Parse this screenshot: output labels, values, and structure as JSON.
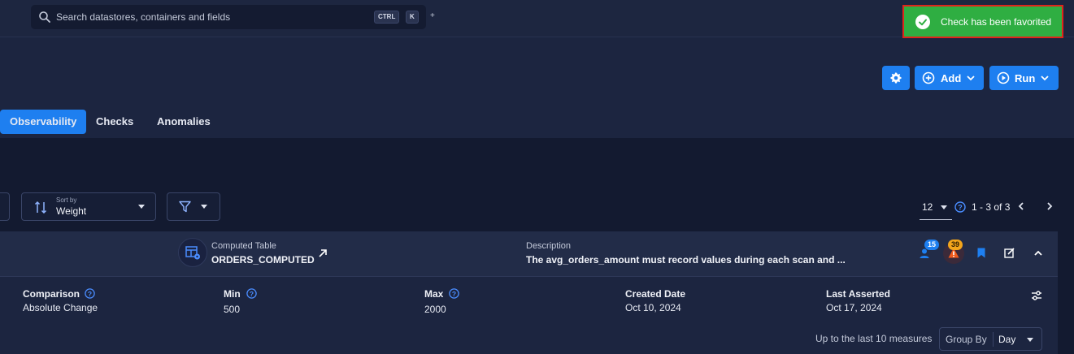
{
  "search": {
    "placeholder": "Search datastores, containers and fields",
    "shortcut_key1": "CTRL",
    "shortcut_plus": "+",
    "shortcut_key2": "K"
  },
  "toast": {
    "message": "Check has been favorited",
    "color": "#2fae42"
  },
  "actions": {
    "settings_icon": "gear-icon",
    "add_label": "Add",
    "run_label": "Run",
    "accent": "#1e7ff0"
  },
  "tabs": [
    {
      "label": "Observability",
      "active": true
    },
    {
      "label": "Checks",
      "active": false
    },
    {
      "label": "Anomalies",
      "active": false
    }
  ],
  "controls": {
    "sort_by_label": "Sort by",
    "sort_by_value": "Weight",
    "page_size": "12",
    "pagination_text": "1 - 3 of 3"
  },
  "card": {
    "container_type_label": "Computed Table",
    "container_name": "ORDERS_COMPUTED",
    "description_label": "Description",
    "description_text": "The avg_orders_amount must record values during each scan and ...",
    "badge_blue": "15",
    "badge_orange": "39",
    "fields": {
      "comparison_label": "Comparison",
      "comparison_value": "Absolute Change",
      "min_label": "Min",
      "min_value": "500",
      "max_label": "Max",
      "max_value": "2000",
      "created_label": "Created Date",
      "created_value": "Oct 10, 2024",
      "asserted_label": "Last Asserted",
      "asserted_value": "Oct 17, 2024"
    },
    "measures_text": "Up to the last 10 measures",
    "group_by_label": "Group By",
    "group_by_value": "Day"
  }
}
